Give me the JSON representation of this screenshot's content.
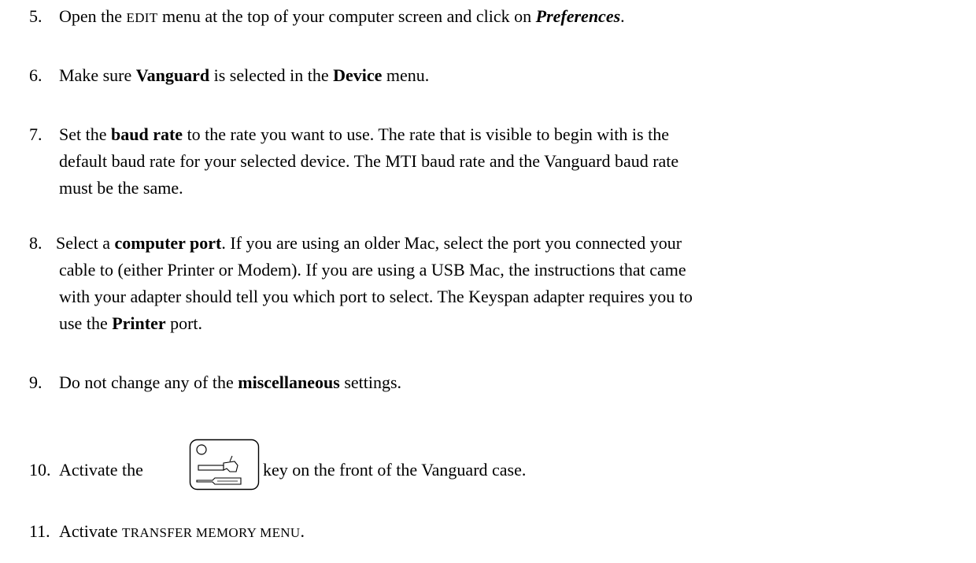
{
  "step5": {
    "num": "5.",
    "a": "Open the ",
    "edit": "EDIT",
    "b": " menu at the top of your computer screen and click on ",
    "pref": "Preferences",
    "c": "."
  },
  "step6": {
    "num": "6.",
    "a": "Make sure ",
    "vanguard": "Vanguard",
    "b": " is selected in the ",
    "device": "Device",
    "c": " menu."
  },
  "step7": {
    "num": "7.",
    "a": "Set the ",
    "baud": "baud rate",
    "b": " to the rate you want to use.  The rate that is visible to begin with is the",
    "line2": "default baud rate for your selected device.  The MTI baud rate and the Vanguard baud rate",
    "line3": "must be the same."
  },
  "step8": {
    "num": "8.",
    "a": "Select a ",
    "port": "computer port",
    "b": ".  If you are using an older Mac, select the port you connected your",
    "line2": "cable to (either Printer or Modem).  If you are using a USB Mac, the instructions that came",
    "line3": "with your adapter should tell you which port to select.  The Keyspan adapter requires you to",
    "line4a": "use the ",
    "printer": "Printer",
    "line4b": " port."
  },
  "step9": {
    "num": "9.",
    "a": "Do not change any of the ",
    "misc": "miscellaneous",
    "b": " settings."
  },
  "step10": {
    "num": "10.",
    "a": "Activate the",
    "b": "key on the front of the Vanguard case.",
    "icon": "toolbox-key-icon"
  },
  "step11": {
    "num": "11.",
    "a": "Activate ",
    "menu": "TRANSFER MEMORY MENU",
    "b": "."
  }
}
